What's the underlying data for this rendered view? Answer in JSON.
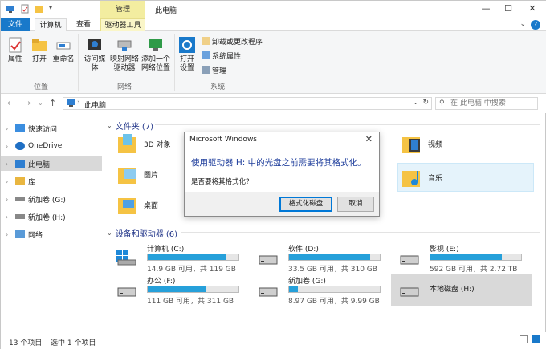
{
  "titlebar": {
    "context_tab": "管理",
    "title": "此电脑",
    "min": "—",
    "max": "☐",
    "close": "✕"
  },
  "tabs": {
    "file": "文件",
    "computer": "计算机",
    "view": "查看",
    "drive_tools": "驱动器工具",
    "help": "?"
  },
  "ribbon": {
    "properties": "属性",
    "open": "打开",
    "rename": "重命名",
    "location_group": "位置",
    "access_media": "访问媒体",
    "map_drive": "映射网络驱动器",
    "add_location": "添加一个网络位置",
    "network_group": "网络",
    "open_settings": "打开设置",
    "uninstall": "卸载或更改程序",
    "sys_props": "系统属性",
    "manage": "管理",
    "system_group": "系统"
  },
  "address": {
    "path": "此电脑",
    "search_placeholder": "在 此电脑 中搜索"
  },
  "sidebar": {
    "items": [
      "快速访问",
      "OneDrive",
      "此电脑",
      "库",
      "新加卷 (G:)",
      "新加卷 (H:)",
      "网络"
    ]
  },
  "folders": {
    "header": "文件夹 (7)",
    "items": [
      "3D 对象",
      "视频",
      "图片",
      "音乐",
      "桌面"
    ]
  },
  "drives": {
    "header": "设备和驱动器 (6)",
    "items": [
      {
        "name": "计算机 (C:)",
        "cap": "14.9 GB 可用，共 119 GB",
        "used": 0.87
      },
      {
        "name": "软件 (D:)",
        "cap": "33.5 GB 可用，共 310 GB",
        "used": 0.89
      },
      {
        "name": "影视 (E:)",
        "cap": "592 GB 可用，共 2.72 TB",
        "used": 0.79
      },
      {
        "name": "办公 (F:)",
        "cap": "111 GB 可用，共 311 GB",
        "used": 0.64
      },
      {
        "name": "新加卷 (G:)",
        "cap": "8.97 GB 可用，共 9.99 GB",
        "used": 0.1
      },
      {
        "name": "本地磁盘 (H:)"
      }
    ]
  },
  "status": {
    "count": "13 个项目",
    "selected": "选中 1 个项目"
  },
  "dialog": {
    "title": "Microsoft Windows",
    "message": "使用驱动器 H: 中的光盘之前需要将其格式化。",
    "question": "是否要将其格式化?",
    "format_btn": "格式化磁盘",
    "cancel_btn": "取消"
  },
  "colors": {
    "accent": "#1979ca",
    "bar": "#26a0da",
    "header_text": "#1e3287"
  }
}
